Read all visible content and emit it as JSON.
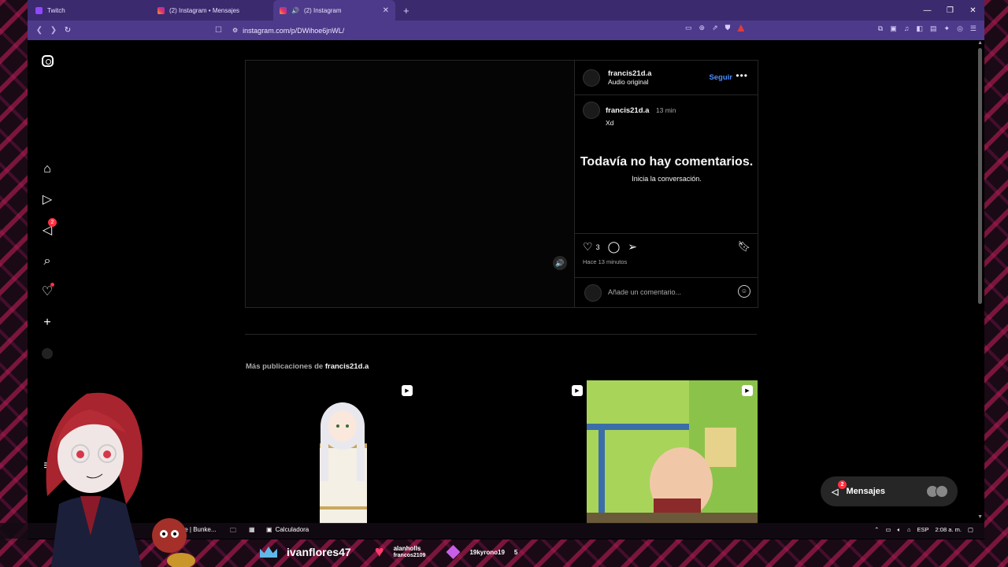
{
  "browser": {
    "tabs": [
      {
        "label": "Twitch",
        "icon": "twitch-icon",
        "active": false
      },
      {
        "label": "(2) Instagram • Mensajes",
        "icon": "instagram-icon",
        "active": false
      },
      {
        "label": "(2) Instagram",
        "icon": "instagram-icon",
        "active": true
      }
    ],
    "url": "instagram.com/p/DWihoe6jnWL/",
    "accent": "#4d3a8a"
  },
  "instagram": {
    "post": {
      "username": "francis21d.a",
      "audio": "Audio original",
      "follow_label": "Seguir",
      "caption_user": "francis21d.a",
      "caption_time": "13 min",
      "caption_text": "Xd",
      "empty_title": "Todavía no hay comentarios.",
      "empty_sub": "Inicia la conversación.",
      "like_count": "3",
      "posted_ago": "Hace 13 minutos",
      "comment_placeholder": "Añade un comentario..."
    },
    "more_posts": {
      "prefix": "Más publicaciones de",
      "username": "francis21d.a"
    },
    "sidebar": {
      "messages_badge": "2"
    },
    "messages_pill": {
      "label": "Mensajes",
      "badge": "2"
    }
  },
  "taskbar": {
    "item1": "te | Bunke...",
    "item2": "Calculadora",
    "lang": "ESP",
    "clock": "2:08 a. m."
  },
  "stream_overlay": {
    "viewer_name": "ivanflores47",
    "heart_user1": "alanholls",
    "heart_user2": "francos2109",
    "gem_user": "19kyrono19",
    "gem_count": "5"
  }
}
